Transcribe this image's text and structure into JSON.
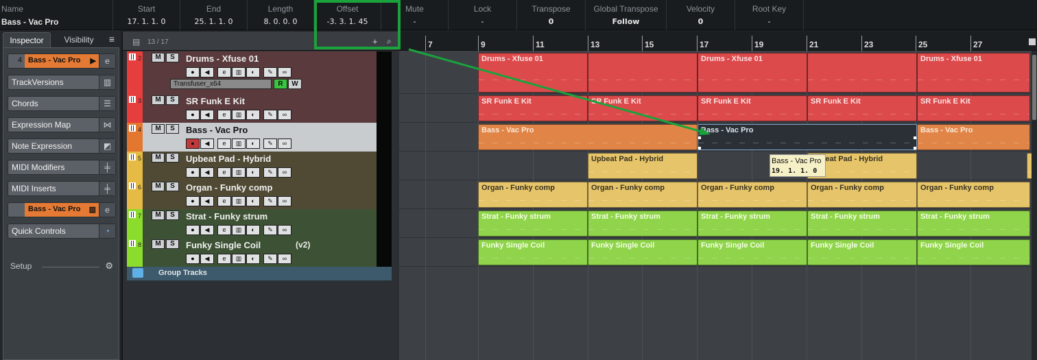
{
  "infoline": {
    "fields": [
      {
        "label": "Name",
        "value": "Bass - Vac Pro"
      },
      {
        "label": "Start",
        "value": "17. 1. 1.   0"
      },
      {
        "label": "End",
        "value": "25. 1. 1.   0"
      },
      {
        "label": "Length",
        "value": "8. 0. 0.   0"
      },
      {
        "label": "Offset",
        "value": "-3. 3. 1.  45"
      },
      {
        "label": "Mute",
        "value": "-"
      },
      {
        "label": "Lock",
        "value": "-"
      },
      {
        "label": "Transpose",
        "value": "0"
      },
      {
        "label": "Global Transpose",
        "value": "Follow"
      },
      {
        "label": "Velocity",
        "value": "0"
      },
      {
        "label": "Root Key",
        "value": "-"
      }
    ],
    "highlight_color": "#1aa33c"
  },
  "inspector": {
    "tabs": {
      "inspector": "Inspector",
      "visibility": "Visibility"
    },
    "menu_icon": "≡",
    "track_row": {
      "number": "4",
      "name": "Bass - Vac Pro",
      "arrow": "▶",
      "icon": "e"
    },
    "sections": [
      {
        "label": "TrackVersions",
        "icon": "trackversions-icon"
      },
      {
        "label": "Chords",
        "icon": "chords-icon"
      },
      {
        "label": "Expression Map",
        "icon": "expression-map-icon"
      },
      {
        "label": "Note Expression",
        "icon": "note-expression-icon"
      },
      {
        "label": "MIDI Modifiers",
        "icon": "midi-modifiers-icon"
      },
      {
        "label": "MIDI Inserts",
        "icon": "midi-inserts-icon"
      }
    ],
    "channel_row": {
      "name": "Bass - Vac Pro",
      "icon": "e"
    },
    "quick_controls": {
      "label": "Quick Controls",
      "icon": "quick-controls-icon"
    },
    "setup": {
      "label": "Setup",
      "icon": "gear-icon"
    }
  },
  "tracklist": {
    "count": "13 / 17",
    "tracks": [
      {
        "num": "2",
        "name": "Drums - Xfuse 01",
        "suffix": "",
        "color": "#e63d3d",
        "body": "#5a3a3c",
        "insert": "Transfuser_x64",
        "selected": false,
        "rec_on": false
      },
      {
        "num": "3",
        "name": "SR Funk E Kit",
        "suffix": "",
        "color": "#e63d3d",
        "body": "#5a3a3c",
        "selected": false,
        "rec_on": false
      },
      {
        "num": "4",
        "name": "Bass - Vac Pro",
        "suffix": "",
        "color": "#e3772f",
        "body": "#c9cccf",
        "selected": true,
        "rec_on": true
      },
      {
        "num": "5",
        "name": "Upbeat Pad - Hybrid",
        "suffix": "",
        "color": "#e6bb45",
        "body": "#504a35",
        "selected": false,
        "rec_on": false
      },
      {
        "num": "6",
        "name": "Organ - Funky comp",
        "suffix": "",
        "color": "#e6bb45",
        "body": "#504a35",
        "selected": false,
        "rec_on": false
      },
      {
        "num": "7",
        "name": "Strat - Funky strum",
        "suffix": "",
        "color": "#8bdc2d",
        "body": "#3d5234",
        "selected": false,
        "rec_on": false
      },
      {
        "num": "8",
        "name": "Funky Single Coil",
        "suffix": "(v2)",
        "color": "#8bdc2d",
        "body": "#3d5234",
        "selected": false,
        "rec_on": false
      }
    ],
    "group": "Group Tracks",
    "buttons": {
      "mute": "M",
      "solo": "S",
      "read": "R",
      "write": "W"
    }
  },
  "ruler": {
    "bars": [
      "7",
      "9",
      "11",
      "13",
      "15",
      "17",
      "19",
      "21",
      "23",
      "25",
      "27"
    ]
  },
  "events": {
    "drums": "Drums - Xfuse 01",
    "kit": "SR Funk E Kit",
    "bass": "Bass - Vac Pro",
    "pad": "Upbeat Pad - Hybrid",
    "organ": "Organ - Funky comp",
    "strat": "Strat - Funky strum",
    "coil": "Funky Single Coil"
  },
  "tooltip": {
    "name": "Bass - Vac Pro",
    "position": "19. 1. 1.  0"
  }
}
